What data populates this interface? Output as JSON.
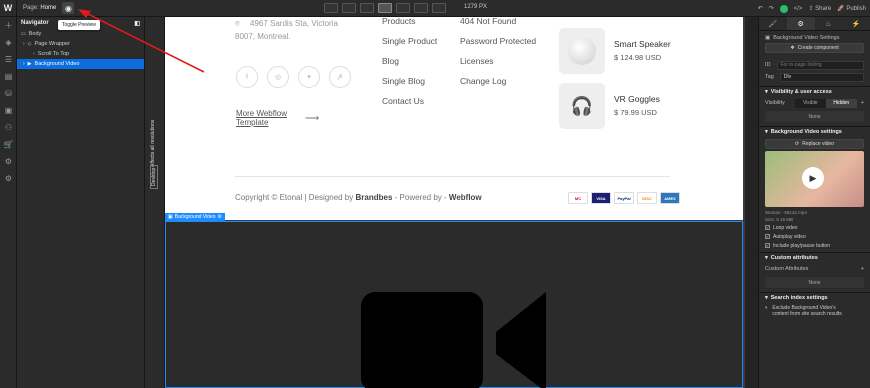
{
  "topbar": {
    "logo": "W",
    "page_prefix": "Page:",
    "page_name": "Home",
    "tooltip": "Toggle Preview",
    "width": "1279 PX",
    "share": "Share",
    "publish": "Publish"
  },
  "navigator": {
    "title": "Navigator",
    "items": [
      {
        "label": "Body",
        "indent": 0
      },
      {
        "label": "Page Wrapper",
        "indent": 1
      },
      {
        "label": "Scroll To Top",
        "indent": 2
      },
      {
        "label": "Background Video",
        "indent": 1,
        "selected": true
      }
    ]
  },
  "strip": {
    "affects": "Affects all resolutions",
    "desktop": "Desktop"
  },
  "canvas": {
    "address_line1": "4967 Sardis Sta, Victoria",
    "address_line2": "8007, Montreal.",
    "more_link_line1": "More Webflow",
    "more_link_line2": "Template",
    "col1": [
      "Products",
      "Single Product",
      "Blog",
      "Single Blog",
      "Contact Us"
    ],
    "col2": [
      "404 Not Found",
      "Password Protected",
      "Licenses",
      "Change Log"
    ],
    "products": [
      {
        "name": "Smart Speaker",
        "price": "$ 124.98 USD"
      },
      {
        "name": "VR Goggles",
        "price": "$ 79.99 USD"
      }
    ],
    "copyright_pre": "Copyright © Etonal | Designed by",
    "copyright_brand": "Brandbes",
    "copyright_mid": "- Powered by -",
    "copyright_webflow": "Webflow",
    "cards": [
      {
        "label": "MC",
        "color": "#eb001b"
      },
      {
        "label": "VISA",
        "color": "#1a1f71"
      },
      {
        "label": "PayPal",
        "color": "#003087"
      },
      {
        "label": "DISC",
        "color": "#f58220"
      },
      {
        "label": "AMEX",
        "color": "#2e77bc"
      }
    ],
    "bgvideo_label": "Background Video"
  },
  "panel": {
    "section_title": "Background Video Settings",
    "create_component": "Create component",
    "id_label": "ID",
    "id_placeholder": "For in-page linking",
    "tag_label": "Tag",
    "tag_value": "Div",
    "visibility_header": "Visibility & user access",
    "visibility_label": "Visibility",
    "visible": "Visible",
    "hidden": "Hidden",
    "none": "None",
    "bgv_header": "Background Video settings",
    "replace_video": "Replace video",
    "file_name": "Woman - 58142.mp4",
    "file_size": "Size: 9.15 MB",
    "checks": [
      "Loop video",
      "Autoplay video",
      "Include play/pause button"
    ],
    "custom_attr_header": "Custom attributes",
    "custom_attr_label": "Custom Attributes",
    "custom_attr_none": "None",
    "search_header": "Search index settings",
    "search_text_1": "Exclude Background Video's",
    "search_text_2": "content from site search results"
  }
}
